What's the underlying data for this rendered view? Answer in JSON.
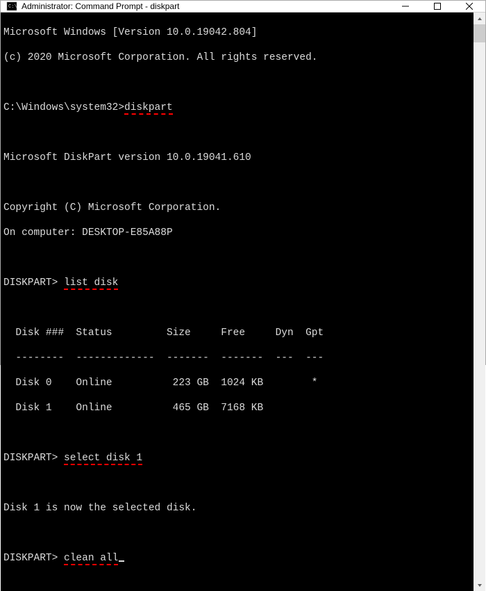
{
  "titlebar": {
    "title": "Administrator: Command Prompt - diskpart"
  },
  "term": {
    "ver_line": "Microsoft Windows [Version 10.0.19042.804]",
    "copy_line": "(c) 2020 Microsoft Corporation. All rights reserved.",
    "prompt1_prefix": "C:\\Windows\\system32>",
    "cmd1": "diskpart",
    "dp_ver": "Microsoft DiskPart version 10.0.19041.610",
    "dp_copy": "Copyright (C) Microsoft Corporation.",
    "dp_on": "On computer: DESKTOP-E85A88P",
    "dp_prompt": "DISKPART> ",
    "cmd2": "list disk",
    "tbl_border": "  --------  -------------  -------  -------  ---  ---",
    "tbl_header": "  Disk ###  Status         Size     Free     Dyn  Gpt",
    "disk0": "  Disk 0    Online          223 GB  1024 KB        *",
    "disk1": "  Disk 1    Online          465 GB  7168 KB",
    "cmd3": "select disk 1",
    "sel_msg": "Disk 1 is now the selected disk.",
    "cmd4": "clean all"
  },
  "chart_data": {
    "type": "table",
    "title": "list disk",
    "columns": [
      "Disk ###",
      "Status",
      "Size",
      "Free",
      "Dyn",
      "Gpt"
    ],
    "rows": [
      {
        "Disk ###": "Disk 0",
        "Status": "Online",
        "Size": "223 GB",
        "Free": "1024 KB",
        "Dyn": "",
        "Gpt": "*"
      },
      {
        "Disk ###": "Disk 1",
        "Status": "Online",
        "Size": "465 GB",
        "Free": "7168 KB",
        "Dyn": "",
        "Gpt": ""
      }
    ]
  }
}
